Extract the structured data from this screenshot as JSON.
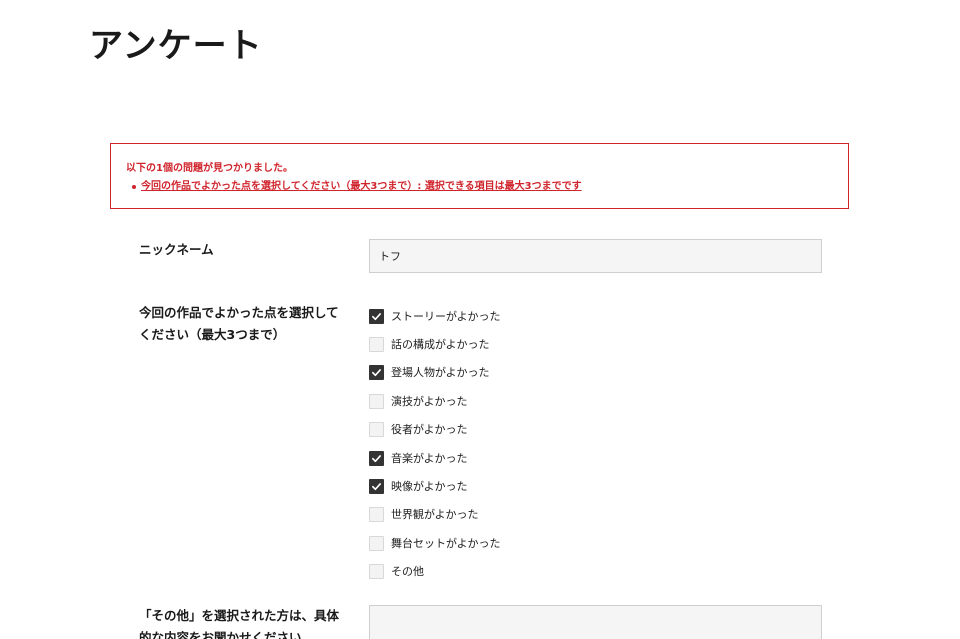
{
  "page": {
    "title": "アンケート"
  },
  "error": {
    "heading": "以下の1個の問題が見つかりました。",
    "items": [
      "今回の作品でよかった点を選択してください（最大3つまで）: 選択できる項目は最大3つまでです"
    ],
    "color": "#d0242c"
  },
  "form": {
    "nickname": {
      "label": "ニックネーム",
      "value": "トフ"
    },
    "good_points": {
      "label": "今回の作品でよかった点を選択してください（最大3つまで）",
      "options": [
        {
          "label": "ストーリーがよかった",
          "checked": true
        },
        {
          "label": "話の構成がよかった",
          "checked": false
        },
        {
          "label": "登場人物がよかった",
          "checked": true
        },
        {
          "label": "演技がよかった",
          "checked": false
        },
        {
          "label": "役者がよかった",
          "checked": false
        },
        {
          "label": "音楽がよかった",
          "checked": true
        },
        {
          "label": "映像がよかった",
          "checked": true
        },
        {
          "label": "世界観がよかった",
          "checked": false
        },
        {
          "label": "舞台セットがよかった",
          "checked": false
        },
        {
          "label": "その他",
          "checked": false
        }
      ]
    },
    "other_detail": {
      "label": "「その他」を選択された方は、具体的な内容をお聞かせください",
      "value": ""
    }
  },
  "colors": {
    "checkbox_checked": "#333333",
    "input_background": "#f5f5f5"
  }
}
